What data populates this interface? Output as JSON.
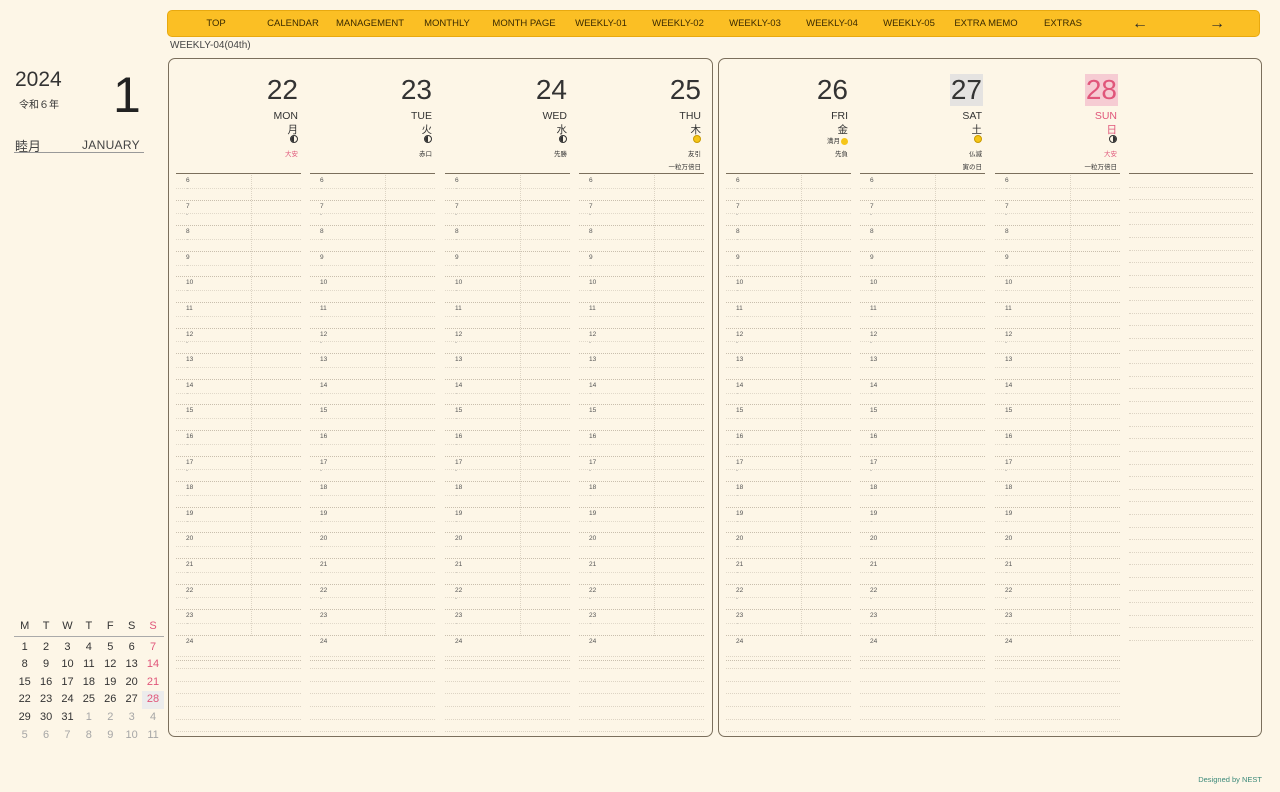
{
  "nav": {
    "items": [
      "TOP",
      "CALENDAR",
      "MANAGEMENT",
      "MONTHLY",
      "MONTH PAGE",
      "WEEKLY-01",
      "WEEKLY-02",
      "WEEKLY-03",
      "WEEKLY-04",
      "WEEKLY-05",
      "EXTRA MEMO",
      "EXTRAS"
    ],
    "prev": "←",
    "next": "→"
  },
  "week_label": "WEEKLY-04(04th)",
  "sidebar": {
    "year": "2024",
    "era": "令和６年",
    "month_number": "1",
    "month_jp": "睦月",
    "month_en": "JANUARY"
  },
  "mini_calendar": {
    "headers": [
      "M",
      "T",
      "W",
      "T",
      "F",
      "S",
      "S"
    ],
    "weeks": [
      [
        "1",
        "2",
        "3",
        "4",
        "5",
        "6",
        "7"
      ],
      [
        "8",
        "9",
        "10",
        "11",
        "12",
        "13",
        "14"
      ],
      [
        "15",
        "16",
        "17",
        "18",
        "19",
        "20",
        "21"
      ],
      [
        "22",
        "23",
        "24",
        "25",
        "26",
        "27",
        "28"
      ],
      [
        "29",
        "30",
        "31",
        "1",
        "2",
        "3",
        "4"
      ],
      [
        "5",
        "6",
        "7",
        "8",
        "9",
        "10",
        "11"
      ]
    ]
  },
  "days": [
    {
      "num": "22",
      "en": "MON",
      "jp": "月",
      "moon": "first",
      "rokuyo": "大安",
      "extra": ""
    },
    {
      "num": "23",
      "en": "TUE",
      "jp": "火",
      "moon": "first",
      "rokuyo": "赤口",
      "extra": ""
    },
    {
      "num": "24",
      "en": "WED",
      "jp": "水",
      "moon": "first",
      "rokuyo": "先勝",
      "extra": ""
    },
    {
      "num": "25",
      "en": "THU",
      "jp": "木",
      "moon": "full",
      "rokuyo": "友引",
      "extra": "一粒万倍日"
    },
    {
      "num": "26",
      "en": "FRI",
      "jp": "金",
      "moon": "none",
      "moon_text": "満月",
      "rokuyo": "先負",
      "extra": ""
    },
    {
      "num": "27",
      "en": "SAT",
      "jp": "土",
      "moon": "full",
      "rokuyo": "仏滅",
      "extra": "寅の日"
    },
    {
      "num": "28",
      "en": "SUN",
      "jp": "日",
      "moon": "last",
      "rokuyo": "大安",
      "extra": "一粒万倍日"
    }
  ],
  "hours": [
    "6",
    "7",
    "8",
    "9",
    "10",
    "11",
    "12",
    "13",
    "14",
    "15",
    "16",
    "17",
    "18",
    "19",
    "20",
    "21",
    "22",
    "23",
    "24"
  ],
  "half_mark": "-",
  "footer": "Designed by NEST"
}
